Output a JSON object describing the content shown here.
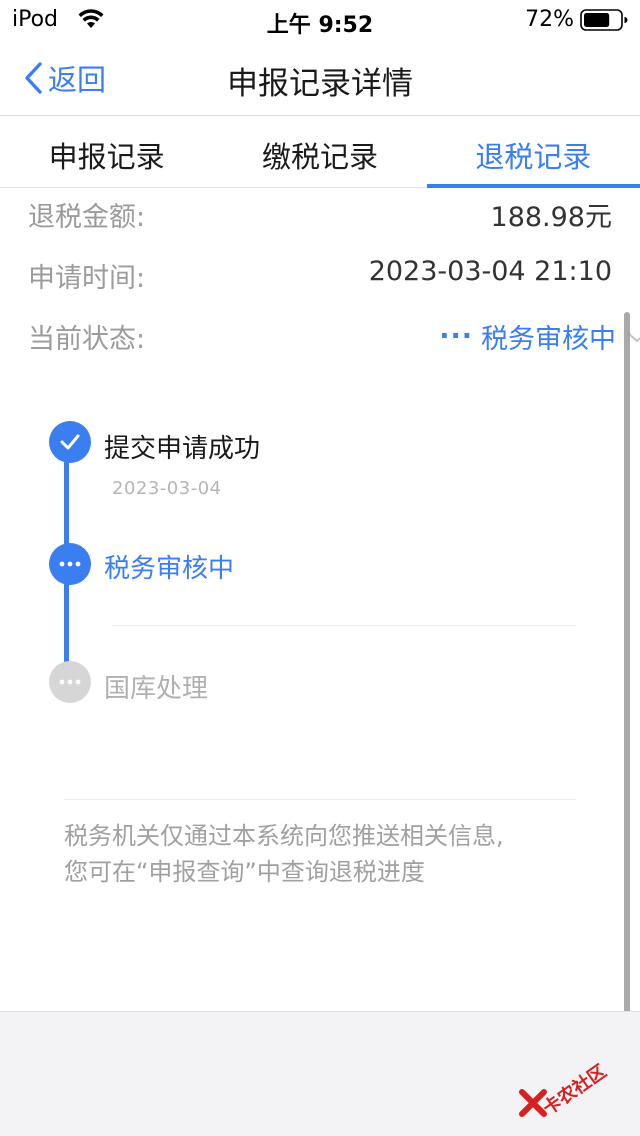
{
  "status_bar": {
    "carrier": "iPod",
    "time": "上午 9:52",
    "battery_percent": "72%",
    "battery_level": 0.72,
    "wifi_icon": "wifi-icon",
    "battery_icon": "battery-icon"
  },
  "nav": {
    "back_label": "返回",
    "title": "申报记录详情",
    "back_icon": "chevron-left-icon"
  },
  "tabs": [
    {
      "label": "申报记录",
      "active": false
    },
    {
      "label": "缴税记录",
      "active": false
    },
    {
      "label": "退税记录",
      "active": true
    }
  ],
  "info": {
    "amount_label": "退税金额:",
    "amount_value": "188.98元",
    "time_label": "申请时间:",
    "time_value": "2023-03-04 21:10",
    "status_label": "当前状态:",
    "status_dots": "···",
    "status_value": "税务审核中"
  },
  "timeline": [
    {
      "title": "提交申请成功",
      "date": "2023-03-04",
      "state": "done",
      "icon": "check-icon"
    },
    {
      "title": "税务审核中",
      "date": "",
      "state": "current",
      "icon": "ellipsis-icon"
    },
    {
      "title": "国库处理",
      "date": "",
      "state": "pending",
      "icon": "ellipsis-icon"
    }
  ],
  "notice": {
    "line1": "税务机关仅通过本系统向您推送相关信息,",
    "line2": "您可在“申报查询”中查询退税进度"
  },
  "watermark": {
    "text": "卡农社区"
  },
  "colors": {
    "accent": "#3a7ef0",
    "muted": "#9b9b9b",
    "pending": "#d6d6d6"
  }
}
